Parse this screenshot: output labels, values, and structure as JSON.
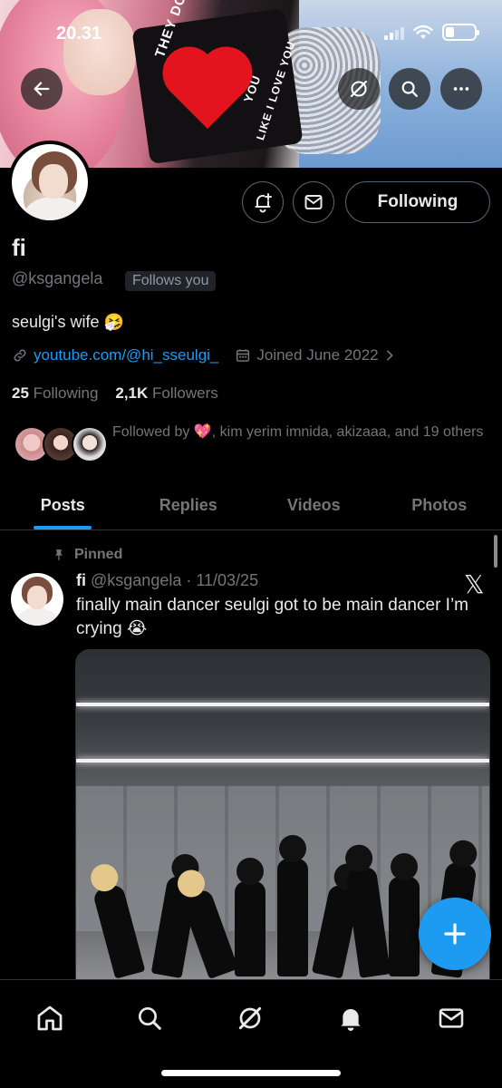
{
  "status_bar": {
    "time": "20.31"
  },
  "banner": {
    "shirt_text_1": "THEY DONT",
    "shirt_text_2": "YOU",
    "shirt_text_3": "LIKE I LOVE YOU"
  },
  "profile": {
    "name": "fi",
    "handle": "@ksgangela",
    "follows_you": "Follows you",
    "bio": "seulgi's wife 🤧",
    "link": "youtube.com/@hi_sseulgi_",
    "joined": "Joined June 2022",
    "following_count": "25",
    "following_label": "Following",
    "followers_count": "2,1K",
    "followers_label": "Followers",
    "followed_by": "Followed by 💖, kim yerim imnida, akizaaa, and 19 others",
    "following_button": "Following"
  },
  "tabs": [
    "Posts",
    "Replies",
    "Videos",
    "Photos"
  ],
  "post": {
    "pinned_label": "Pinned",
    "name": "fi",
    "handle_date": "@ksgangela · 11/03/25",
    "text": "finally main dancer seulgi got to be main dancer I’m crying 😭"
  },
  "icons": {
    "back": "arrow-left-icon",
    "grok": "grok-icon",
    "search": "search-icon",
    "more": "more-icon",
    "notify": "bell-plus-icon",
    "message": "envelope-icon",
    "link": "link-icon",
    "calendar": "calendar-icon",
    "pin": "pin-icon",
    "x_logo": "x-logo-icon",
    "fab": "plus-icon",
    "nav": [
      "home-icon",
      "search-icon",
      "grok-icon",
      "bell-icon",
      "envelope-icon"
    ]
  },
  "colors": {
    "accent": "#1d9bf0",
    "background": "#000000",
    "muted": "#71767b",
    "text": "#e7e9ea"
  }
}
